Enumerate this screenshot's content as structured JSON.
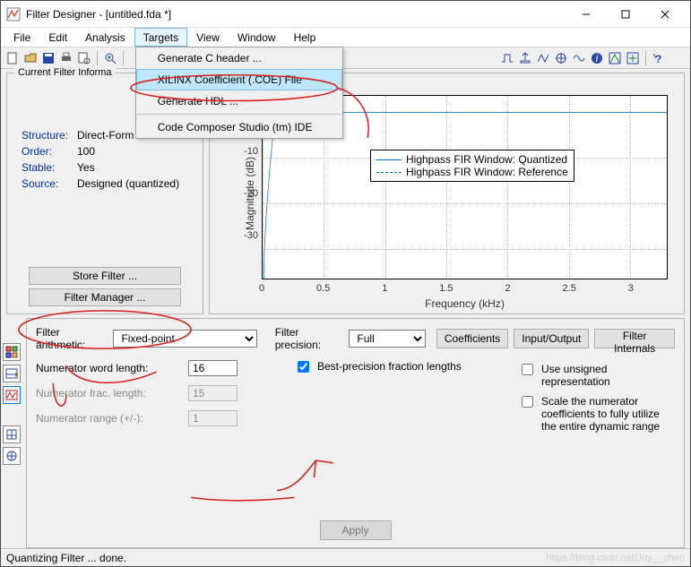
{
  "window": {
    "title": "Filter Designer  -  [untitled.fda *]"
  },
  "menubar": [
    "File",
    "Edit",
    "Analysis",
    "Targets",
    "View",
    "Window",
    "Help"
  ],
  "targets_menu": {
    "items": [
      "Generate C header ...",
      "XILINX Coefficient (.COE) File",
      "Generate HDL ...",
      "Code Composer Studio (tm) IDE"
    ],
    "highlighted_index": 1
  },
  "filter_info": {
    "legend": "Current Filter Informa",
    "structure_label": "Structure:",
    "structure": "Direct-Form FIR",
    "order_label": "Order:",
    "order": "100",
    "stable_label": "Stable:",
    "stable": "Yes",
    "source_label": "Source:",
    "source": "Designed (quantized)",
    "store_btn": "Store Filter ...",
    "manager_btn": "Filter Manager ..."
  },
  "plot": {
    "ylabel": "Magnitude (dB)",
    "xlabel": "Frequency (kHz)",
    "legend": [
      "Highpass FIR Window: Quantized",
      "Highpass FIR Window: Reference"
    ]
  },
  "chart_data": {
    "type": "line",
    "title": "",
    "xlabel": "Frequency (kHz)",
    "ylabel": "Magnitude (dB)",
    "xlim": [
      0,
      3.3
    ],
    "ylim": [
      -35,
      5
    ],
    "xticks": [
      0,
      0.5,
      1,
      1.5,
      2,
      2.5,
      3
    ],
    "yticks": [
      -30,
      -20,
      -10,
      0
    ],
    "series": [
      {
        "name": "Highpass FIR Window: Quantized",
        "style": "solid",
        "x": [
          0,
          0.02,
          0.05,
          0.08,
          0.1,
          0.15,
          0.2,
          0.3,
          0.5,
          1.0,
          2.0,
          3.0,
          3.3
        ],
        "y": [
          -35,
          -30,
          -20,
          -10,
          -3,
          0,
          0,
          0,
          0,
          0,
          0,
          0,
          0
        ]
      },
      {
        "name": "Highpass FIR Window: Reference",
        "style": "dash",
        "x": [
          0,
          0.02,
          0.05,
          0.08,
          0.1,
          0.15,
          0.2,
          0.3,
          0.5,
          1.0,
          2.0,
          3.0,
          3.3
        ],
        "y": [
          -35,
          -30,
          -20,
          -10,
          -3,
          0,
          0,
          0,
          0,
          0,
          0,
          0,
          0
        ]
      }
    ]
  },
  "lower": {
    "arith_label": "Filter arithmetic:",
    "arith_value": "Fixed-point",
    "prec_label": "Filter precision:",
    "prec_value": "Full",
    "tabs": [
      "Coefficients",
      "Input/Output",
      "Filter Internals"
    ],
    "num_wl_label": "Numerator word length:",
    "num_wl": "16",
    "best_prec": "Best-precision fraction lengths",
    "num_frac_label": "Numerator frac. length:",
    "num_frac": "15",
    "num_range_label": "Numerator range (+/-):",
    "num_range": "1",
    "unsigned": "Use unsigned representation",
    "scale": "Scale the numerator coefficients to fully utilize the entire dynamic range",
    "apply": "Apply"
  },
  "status": "Quantizing Filter ... done.",
  "watermark": "https://blog.csdn.net/Joy__chen"
}
